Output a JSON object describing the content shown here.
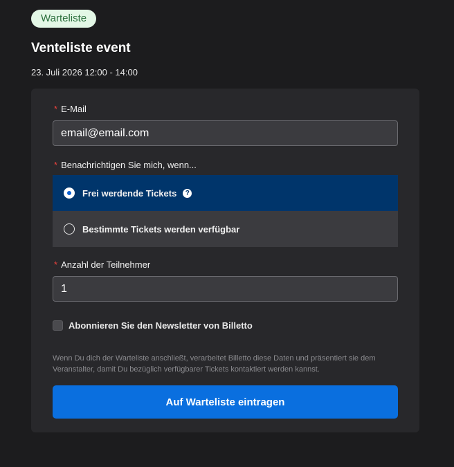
{
  "badge": "Warteliste",
  "event": {
    "title": "Venteliste event",
    "date": "23. Juli 2026 12:00 - 14:00"
  },
  "form": {
    "required_marker": "*",
    "email": {
      "label": "E-Mail",
      "value": "email@email.com"
    },
    "notify": {
      "label": "Benachrichtigen Sie mich, wenn...",
      "options": [
        {
          "label": "Frei werdende Tickets",
          "selected": true,
          "help_icon": "question-circle-icon",
          "help_glyph": "?"
        },
        {
          "label": "Bestimmte Tickets werden verfügbar",
          "selected": false
        }
      ]
    },
    "participants": {
      "label": "Anzahl der Teilnehmer",
      "value": "1"
    },
    "newsletter": {
      "label": "Abonnieren Sie den Newsletter von Billetto",
      "checked": false
    },
    "disclaimer": "Wenn Du dich der Warteliste anschließt, verarbeitet Billetto diese Daten und präsentiert sie dem Veranstalter, damit Du bezüglich verfügbarer Tickets kontaktiert werden kannst.",
    "submit_label": "Auf Warteliste eintragen"
  },
  "colors": {
    "background": "#1c1c1e",
    "card": "#28282b",
    "selected_option": "#00356b",
    "primary_button": "#0a6fdf",
    "required": "#e8413c",
    "badge_bg": "#e3f7e6",
    "badge_text": "#2a6f3c"
  }
}
